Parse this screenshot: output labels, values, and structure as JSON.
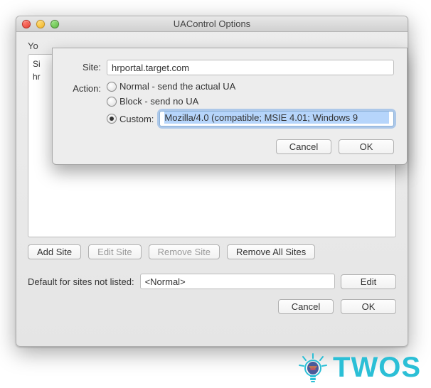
{
  "window": {
    "title": "UAControl Options"
  },
  "bg": {
    "label_left": "Yo",
    "list_items": [
      "Si",
      "hr"
    ],
    "buttons": {
      "add": "Add Site",
      "edit": "Edit Site",
      "remove": "Remove Site",
      "remove_all": "Remove All Sites"
    },
    "default_label": "Default for sites not listed:",
    "default_value": "<Normal>",
    "edit_button": "Edit",
    "cancel": "Cancel",
    "ok": "OK"
  },
  "sheet": {
    "site_label": "Site:",
    "site_value": "hrportal.target.com",
    "action_label": "Action:",
    "options": {
      "normal": "Normal - send the actual UA",
      "block": "Block - send no UA",
      "custom_label": "Custom:",
      "custom_value": "Mozilla/4.0 (compatible; MSIE 4.01; Windows 9"
    },
    "cancel": "Cancel",
    "ok": "OK"
  },
  "logo": {
    "text": "TWOS"
  }
}
